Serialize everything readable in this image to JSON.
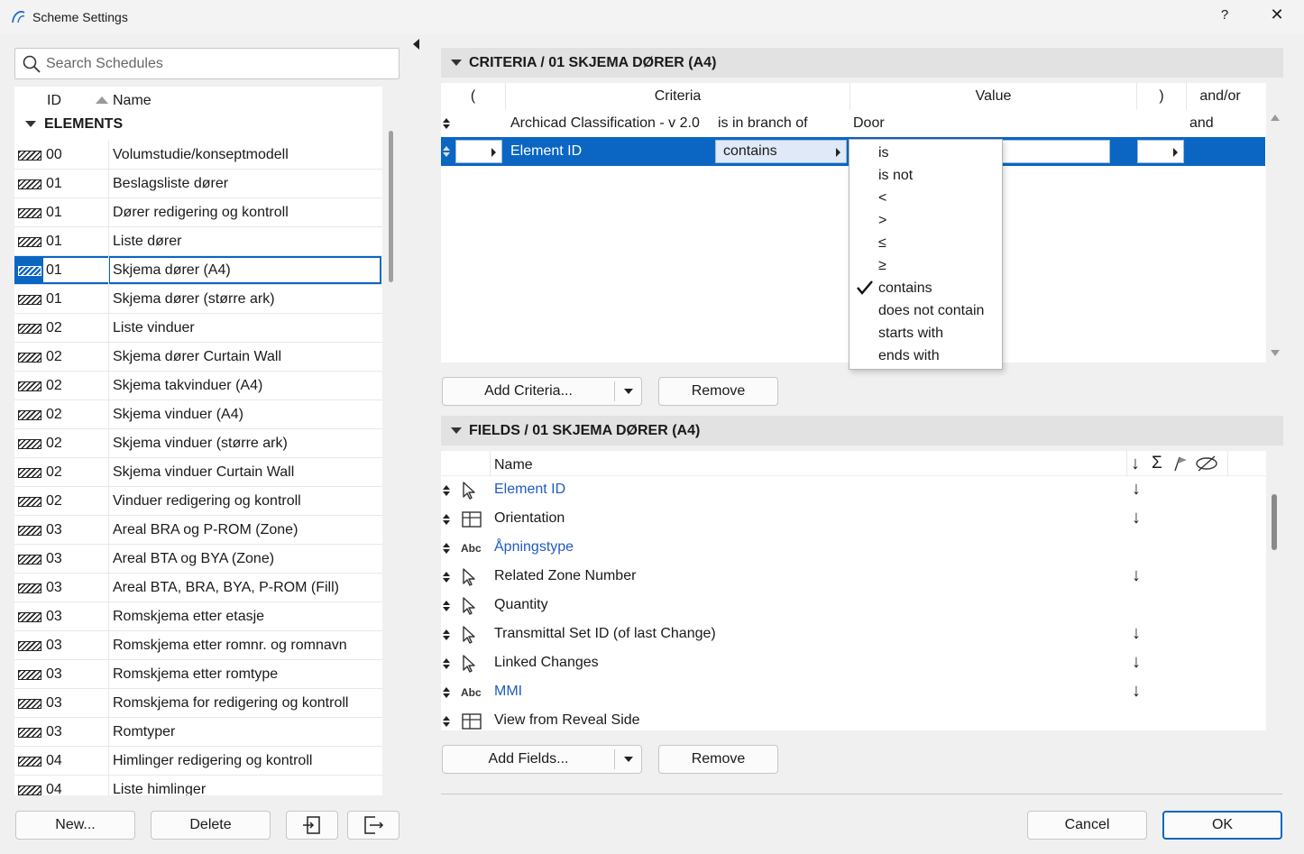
{
  "window": {
    "title": "Scheme Settings",
    "help_label": "?",
    "close_label": "✕"
  },
  "search": {
    "placeholder": "Search Schedules"
  },
  "schedule_list": {
    "header_id": "ID",
    "header_name": "Name",
    "group": "ELEMENTS",
    "selected_index": 4,
    "rows": [
      {
        "id": "00",
        "name": "Volumstudie/konseptmodell"
      },
      {
        "id": "01",
        "name": "Beslagsliste dører"
      },
      {
        "id": "01",
        "name": "Dører redigering og kontroll"
      },
      {
        "id": "01",
        "name": "Liste dører"
      },
      {
        "id": "01",
        "name": "Skjema dører (A4)"
      },
      {
        "id": "01",
        "name": "Skjema dører (større ark)"
      },
      {
        "id": "02",
        "name": "Liste vinduer"
      },
      {
        "id": "02",
        "name": "Skjema dører Curtain Wall"
      },
      {
        "id": "02",
        "name": "Skjema takvinduer (A4)"
      },
      {
        "id": "02",
        "name": "Skjema vinduer (A4)"
      },
      {
        "id": "02",
        "name": "Skjema vinduer (større ark)"
      },
      {
        "id": "02",
        "name": "Skjema vinduer Curtain Wall"
      },
      {
        "id": "02",
        "name": "Vinduer redigering og kontroll"
      },
      {
        "id": "03",
        "name": "Areal BRA og P-ROM (Zone)"
      },
      {
        "id": "03",
        "name": "Areal BTA og BYA (Zone)"
      },
      {
        "id": "03",
        "name": "Areal BTA, BRA, BYA, P-ROM (Fill)"
      },
      {
        "id": "03",
        "name": "Romskjema etter etasje"
      },
      {
        "id": "03",
        "name": "Romskjema etter romnr. og romnavn"
      },
      {
        "id": "03",
        "name": "Romskjema etter romtype"
      },
      {
        "id": "03",
        "name": "Romskjema for redigering og kontroll"
      },
      {
        "id": "03",
        "name": "Romtyper"
      },
      {
        "id": "04",
        "name": "Himlinger redigering og kontroll"
      },
      {
        "id": "04",
        "name": "Liste himlinger"
      }
    ]
  },
  "left_buttons": {
    "new": "New...",
    "delete": "Delete",
    "import_icon": "import-icon",
    "export_icon": "export-icon"
  },
  "criteria": {
    "section_title": "CRITERIA / 01 SKJEMA DØRER (A4)",
    "headers": {
      "open_paren": "(",
      "criteria": "Criteria",
      "value": "Value",
      "close_paren": ")",
      "andor": "and/or"
    },
    "rows": [
      {
        "criteria": "Archicad Classification - v 2.0",
        "operator": "is in branch of",
        "value": "Door",
        "andor": "and"
      },
      {
        "criteria": "Element ID",
        "operator": "contains",
        "value": "",
        "andor": ""
      }
    ],
    "dropdown_options": [
      "is",
      "is not",
      "<",
      ">",
      "≤",
      "≥",
      "contains",
      "does not contain",
      "starts with",
      "ends with"
    ],
    "dropdown_selected": "contains",
    "add_button": "Add Criteria...",
    "remove_button": "Remove"
  },
  "fields": {
    "section_title": "FIELDS / 01 SKJEMA DØRER (A4)",
    "header_name": "Name",
    "header_icons": [
      "sort-down-icon",
      "sum-icon",
      "flag-icon",
      "hidden-icon"
    ],
    "rows": [
      {
        "icon": "pointer-icon",
        "name": "Element ID",
        "blue": true,
        "sort": true
      },
      {
        "icon": "table-icon",
        "name": "Orientation",
        "blue": false,
        "sort": true
      },
      {
        "icon": "abc-icon",
        "name": "Åpningstype",
        "blue": true,
        "sort": false
      },
      {
        "icon": "pointer-icon",
        "name": "Related Zone Number",
        "blue": false,
        "sort": true
      },
      {
        "icon": "pointer-icon",
        "name": "Quantity",
        "blue": false,
        "sort": false
      },
      {
        "icon": "pointer-icon",
        "name": "Transmittal Set ID (of last Change)",
        "blue": false,
        "sort": true
      },
      {
        "icon": "pointer-icon",
        "name": "Linked Changes",
        "blue": false,
        "sort": true
      },
      {
        "icon": "abc-icon",
        "name": "MMI",
        "blue": true,
        "sort": true
      },
      {
        "icon": "table-icon",
        "name": "View from Reveal Side",
        "blue": false,
        "sort": false
      }
    ],
    "add_button": "Add Fields...",
    "remove_button": "Remove"
  },
  "footer": {
    "cancel": "Cancel",
    "ok": "OK"
  },
  "colors": {
    "selection": "#0a66c2",
    "link": "#1f5bc4"
  }
}
